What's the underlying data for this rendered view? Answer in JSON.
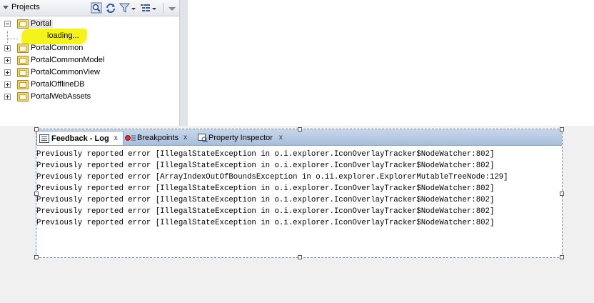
{
  "projects": {
    "title": "Projects",
    "tree": [
      {
        "label": "Portal",
        "expanded": true,
        "selected": true
      },
      {
        "label": "PortalCommon",
        "expanded": false
      },
      {
        "label": "PortalCommonModel",
        "expanded": false
      },
      {
        "label": "PortalCommonView",
        "expanded": false
      },
      {
        "label": "PortalOfflineDB",
        "expanded": false
      },
      {
        "label": "PortalWebAssets",
        "expanded": false
      }
    ],
    "loading_label": "loading...",
    "toolbar_icons": [
      "find-icon",
      "refresh-icon",
      "filter-icon",
      "working-sets-icon",
      "menu-icon"
    ]
  },
  "log_panel": {
    "tabs": [
      {
        "label": "Feedback - Log",
        "close": "x",
        "active": true
      },
      {
        "label": "Breakpoints",
        "close": "x",
        "active": false
      },
      {
        "label": "Property Inspector",
        "close": "x",
        "active": false
      }
    ],
    "lines": [
      "Previously reported error [IllegalStateException in o.i.explorer.IconOverlayTracker$NodeWatcher:802]",
      "Previously reported error [IllegalStateException in o.i.explorer.IconOverlayTracker$NodeWatcher:802]",
      "Previously reported error [ArrayIndexOutOfBoundsException in o.ii.explorer.ExplorerMutableTreeNode:129]",
      "Previously reported error [IllegalStateException in o.i.explorer.IconOverlayTracker$NodeWatcher:802]",
      "Previously reported error [IllegalStateException in o.i.explorer.IconOverlayTracker$NodeWatcher:802]",
      "Previously reported error [IllegalStateException in o.i.explorer.IconOverlayTracker$NodeWatcher:802]",
      "Previously reported error [IllegalStateException in o.i.explorer.IconOverlayTracker$NodeWatcher:802]"
    ]
  },
  "colors": {
    "highlight": "#f4f41c",
    "tab_bar": "#a9bedc",
    "folder": "#f6d86b"
  }
}
